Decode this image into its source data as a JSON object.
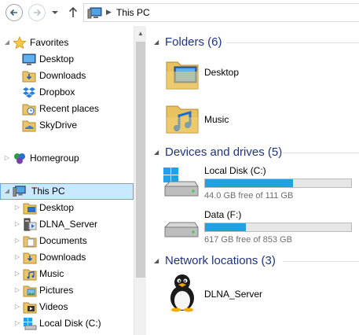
{
  "address": {
    "path_label": "This PC"
  },
  "nav": {
    "favorites": {
      "label": "Favorites",
      "items": [
        {
          "label": "Desktop"
        },
        {
          "label": "Downloads"
        },
        {
          "label": "Dropbox"
        },
        {
          "label": "Recent places"
        },
        {
          "label": "SkyDrive"
        }
      ]
    },
    "homegroup": {
      "label": "Homegroup"
    },
    "this_pc": {
      "label": "This PC",
      "items": [
        {
          "label": "Desktop"
        },
        {
          "label": "DLNA_Server"
        },
        {
          "label": "Documents"
        },
        {
          "label": "Downloads"
        },
        {
          "label": "Music"
        },
        {
          "label": "Pictures"
        },
        {
          "label": "Videos"
        },
        {
          "label": "Local Disk (C:)"
        }
      ]
    }
  },
  "content": {
    "folders": {
      "title": "Folders (6)",
      "items": [
        {
          "label": "Desktop",
          "icon": "desktop-folder-icon"
        },
        {
          "label": "Music",
          "icon": "music-folder-icon"
        }
      ]
    },
    "devices": {
      "title": "Devices and drives (5)",
      "items": [
        {
          "label": "Local Disk (C:)",
          "free_text": "44.0 GB free of 111 GB",
          "used_fraction": 0.6,
          "icon": "windows-drive-icon"
        },
        {
          "label": "Data (F:)",
          "free_text": "617 GB free of 853 GB",
          "used_fraction": 0.28,
          "icon": "drive-icon"
        }
      ]
    },
    "network": {
      "title": "Network locations (3)",
      "items": [
        {
          "label": "DLNA_Server",
          "icon": "penguin-server-icon"
        }
      ]
    }
  },
  "colors": {
    "group_title": "#1e3287",
    "bar_fill": "#26a0da",
    "selection_bg": "#cce8ff",
    "selection_border": "#66a7e8"
  }
}
